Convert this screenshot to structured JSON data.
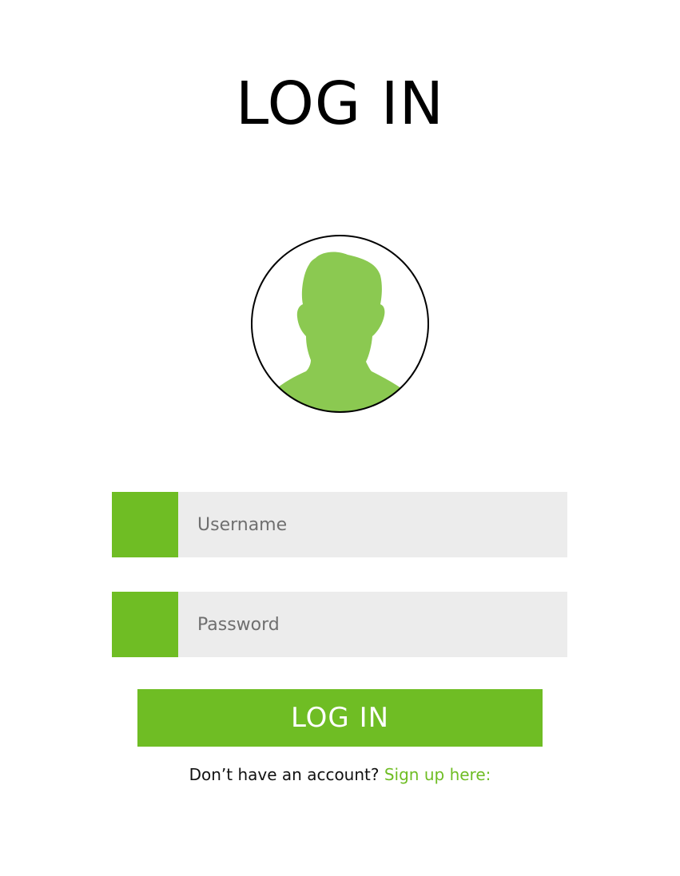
{
  "title": "LOG IN",
  "colors": {
    "accent": "#6fbd24",
    "avatar_fill": "#8bc951",
    "field_bg": "#ececec"
  },
  "avatar": {
    "icon": "user-silhouette-icon"
  },
  "form": {
    "username_placeholder": "Username",
    "password_placeholder": "Password",
    "login_label": "LOG IN"
  },
  "signup": {
    "prompt": "Don’t have an account?",
    "link_label": "Sign up here:"
  }
}
